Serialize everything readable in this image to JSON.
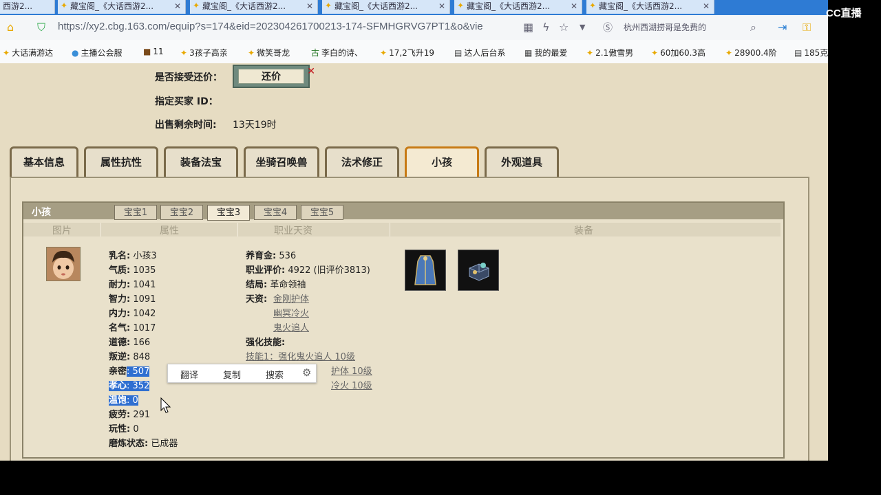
{
  "browser": {
    "tabs": [
      {
        "label": "西游2..."
      },
      {
        "label": "藏宝阁_《大话西游2..."
      },
      {
        "label": "藏宝阁_《大话西游2..."
      },
      {
        "label": "藏宝阁_《大话西游2..."
      },
      {
        "label": "藏宝阁_《大话西游2..."
      },
      {
        "label": "藏宝阁_《大话西游2..."
      }
    ],
    "url": "https://xy2.cbg.163.com/equip?s=174&eid=202304261700213-174-SFMHGRVG7PT1&o&vie",
    "search_text": "杭州西湖捞哥是免费的",
    "bookmarks": [
      "大话满游达",
      "主播公会服",
      "11",
      "3孩子高亲",
      "微笑哥龙",
      "李白的诗、",
      "17,2飞升19",
      "达人后台系",
      "我的最爱",
      "2.1傲雪男",
      "60加60.3高",
      "28900.4阶",
      "185克"
    ],
    "overlay_brand": "CC直播"
  },
  "top_info": {
    "accept_counter_label": "是否接受还价：",
    "counter_button": "还价",
    "buyer_label": "指定买家 ID：",
    "remaining_label": "出售剩余时间:",
    "remaining_value": "13天19时"
  },
  "main_tabs": [
    "基本信息",
    "属性抗性",
    "装备法宝",
    "坐骑召唤兽",
    "法术修正",
    "小孩",
    "外观道具"
  ],
  "panel": {
    "title": "小孩",
    "baby_tabs": [
      "宝宝1",
      "宝宝2",
      "宝宝3",
      "宝宝4",
      "宝宝5"
    ],
    "columns": [
      "图片",
      "属性",
      "职业天资",
      "装备"
    ],
    "attrs": {
      "name": [
        "乳名:",
        "小孩3"
      ],
      "qizhi": [
        "气质:",
        "1035"
      ],
      "naili": [
        "耐力:",
        "1041"
      ],
      "zhili": [
        "智力:",
        "1091"
      ],
      "neili": [
        "内力:",
        "1042"
      ],
      "mingqi": [
        "名气:",
        "1017"
      ],
      "daode": [
        "道德:",
        "166"
      ],
      "panni": [
        "叛逆:",
        "848"
      ],
      "qinmi": [
        "亲密",
        ": 507"
      ],
      "xiaoxin": [
        "孝心",
        ": 352"
      ],
      "wenbao": [
        "温饱",
        ": 0"
      ],
      "pilao": [
        "疲劳:",
        "291"
      ],
      "wanxing": [
        "玩性:",
        "0"
      ],
      "molian": [
        "磨炼状态:",
        "已成器"
      ]
    },
    "career": {
      "yangyu": [
        "养育金:",
        "536"
      ],
      "pingjia": [
        "职业评价:",
        "4922 (旧评价3813)"
      ],
      "jieju": [
        "结局:",
        "革命领袖"
      ],
      "tianzi_label": "天资:",
      "tianzi": [
        "金刚护体",
        "幽冥冷火",
        "鬼火追人"
      ],
      "skill_label": "强化技能:",
      "skills": [
        "技能1：强化鬼火追人 10级",
        "护体 10级",
        "冷火 10级"
      ]
    }
  },
  "context_menu": [
    "翻译",
    "复制",
    "搜索"
  ]
}
